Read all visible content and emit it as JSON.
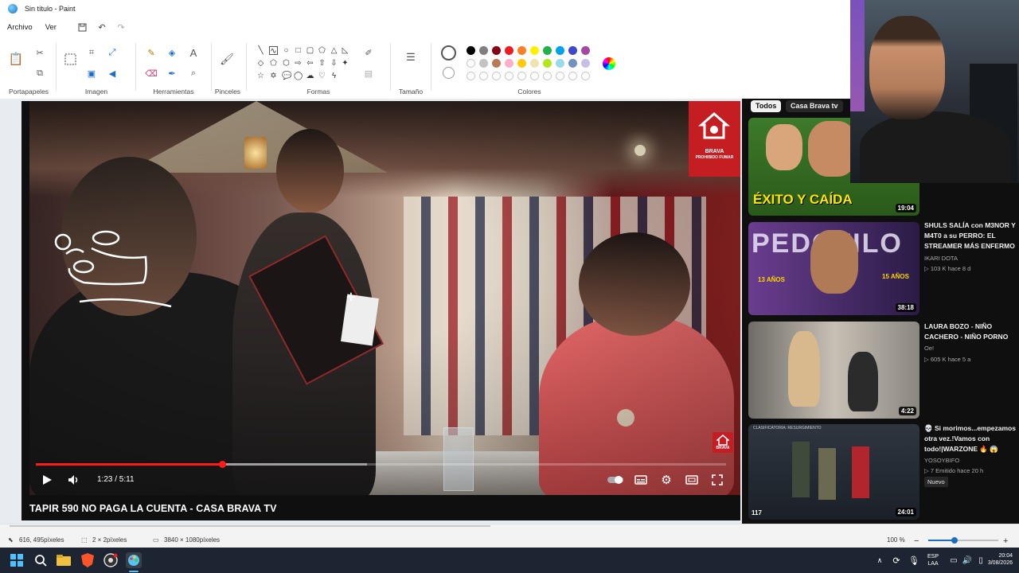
{
  "window": {
    "title": "Sin título - Paint"
  },
  "menu": {
    "file": "Archivo",
    "view": "Ver"
  },
  "ribbon": {
    "groups": {
      "clipboard": "Portapapeles",
      "image": "Imagen",
      "tools": "Herramientas",
      "brushes": "Pinceles",
      "shapes": "Formas",
      "size": "Tamaño",
      "colors": "Colores"
    },
    "palette_row1": [
      "#000000",
      "#7f7f7f",
      "#880015",
      "#ed1c24",
      "#ff7f27",
      "#fff200",
      "#22b14c",
      "#00a2e8",
      "#3f48cc",
      "#a349a4"
    ],
    "palette_row2": [
      "#ffffff",
      "#c3c3c3",
      "#b97a57",
      "#ffaec9",
      "#ffc90e",
      "#efe4b0",
      "#b5e61d",
      "#99d9ea",
      "#7092be",
      "#c8bfe7"
    ]
  },
  "video": {
    "title": "TAPIR 590 NO PAGA LA CUENTA - CASA BRAVA TV",
    "time": "1:23 / 5:11",
    "progress": 0.27,
    "buffered": 0.48,
    "brand_text": "BRAVA",
    "sign_text": "PROHIBIDO FUMAR"
  },
  "sidebar": {
    "chips": [
      "Todos",
      "Casa Brava tv"
    ],
    "items": [
      {
        "title": "",
        "thumb_text": "ÉXITO Y CAÍDA",
        "duration": "19:04",
        "channel": "",
        "meta": "",
        "badge": ""
      },
      {
        "title": "SHULS SALÍA con M3NOR Y M4T0 a su PERRO: EL STREAMER MÁS ENFERMO",
        "thumb_text": "PEDOFILO",
        "thumb_tag1": "13 AÑOS",
        "thumb_tag2": "15 AÑOS",
        "duration": "38:18",
        "channel": "IKARI DOTA",
        "meta": "▷ 103 K  hace 8 d",
        "badge": ""
      },
      {
        "title": "LAURA BOZO - NIÑO CACHERO - NIÑO PORNO",
        "thumb_text": "",
        "duration": "4:22",
        "channel": "Oe!",
        "meta": "▷ 605 K  hace 5 a",
        "badge": ""
      },
      {
        "title": "💀 Si morimos...empezamos otra vez.!Vamos con todo!|WARZONE 🔥 😱",
        "thumb_text": "CLASIFICATORIA: RESURGIMIENTO",
        "thumb_count": "117",
        "duration": "24:01",
        "channel": "YOSOYBIFO",
        "meta": "▷ 7  Emitido hace 20 h",
        "badge": "Nuevo"
      }
    ]
  },
  "statusbar": {
    "cursor_pos": "616, 495píxeles",
    "selection_size": "2 × 2píxeles",
    "image_size": "3840 × 1080píxeles",
    "zoom": "100 %"
  },
  "taskbar": {
    "lang_line1": "ESP",
    "lang_line2": "LAA",
    "time": "20:04",
    "date": "3/08/2026"
  }
}
